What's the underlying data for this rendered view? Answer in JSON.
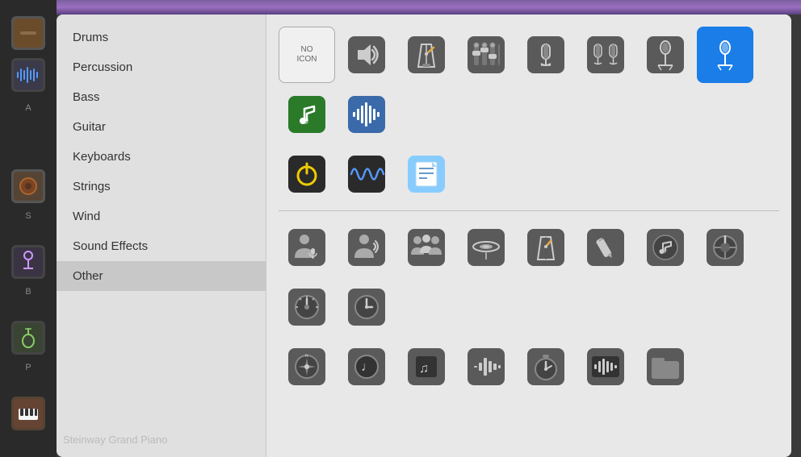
{
  "nav": {
    "items": [
      {
        "id": "drums",
        "label": "Drums",
        "active": false
      },
      {
        "id": "percussion",
        "label": "Percussion",
        "active": false
      },
      {
        "id": "bass",
        "label": "Bass",
        "active": false
      },
      {
        "id": "guitar",
        "label": "Guitar",
        "active": false
      },
      {
        "id": "keyboards",
        "label": "Keyboards",
        "active": false
      },
      {
        "id": "strings",
        "label": "Strings",
        "active": false
      },
      {
        "id": "wind",
        "label": "Wind",
        "active": false
      },
      {
        "id": "sound-effects",
        "label": "Sound Effects",
        "active": false
      },
      {
        "id": "other",
        "label": "Other",
        "active": true
      }
    ]
  },
  "icons": {
    "row1": [
      {
        "id": "no-icon",
        "type": "no-icon",
        "label": "NO ICON"
      },
      {
        "id": "speaker",
        "type": "speaker"
      },
      {
        "id": "metronome",
        "type": "metronome"
      },
      {
        "id": "mixer",
        "type": "mixer"
      },
      {
        "id": "mic-condenser",
        "type": "mic-condenser"
      },
      {
        "id": "mic-pair",
        "type": "mic-pair"
      },
      {
        "id": "mic-stand",
        "type": "mic-stand"
      },
      {
        "id": "mic-stand-selected",
        "type": "mic-stand-selected",
        "selected": true
      },
      {
        "id": "music-note-green",
        "type": "music-note-green"
      },
      {
        "id": "waveform-blue",
        "type": "waveform-blue"
      }
    ],
    "row2": [
      {
        "id": "power-yellow",
        "type": "power-yellow"
      },
      {
        "id": "waveform-wave",
        "type": "waveform-wave"
      },
      {
        "id": "notes-doc",
        "type": "notes-doc"
      }
    ],
    "row3": [
      {
        "id": "person-mic",
        "type": "person-mic"
      },
      {
        "id": "person-talking",
        "type": "person-talking"
      },
      {
        "id": "group",
        "type": "group"
      },
      {
        "id": "cymbal",
        "type": "cymbal"
      },
      {
        "id": "metronome2",
        "type": "metronome2"
      },
      {
        "id": "pencil",
        "type": "pencil"
      },
      {
        "id": "music-circle",
        "type": "music-circle"
      },
      {
        "id": "knob",
        "type": "knob"
      },
      {
        "id": "dial",
        "type": "dial"
      },
      {
        "id": "clock",
        "type": "clock"
      }
    ],
    "row4": [
      {
        "id": "compass",
        "type": "compass"
      },
      {
        "id": "music-note2",
        "type": "music-note2"
      },
      {
        "id": "note-dark",
        "type": "note-dark"
      },
      {
        "id": "waveform2",
        "type": "waveform2"
      },
      {
        "id": "timer",
        "type": "timer"
      },
      {
        "id": "waveform3",
        "type": "waveform3"
      },
      {
        "id": "folder",
        "type": "folder"
      }
    ]
  },
  "daw": {
    "bottom_label": "Steinway Grand Piano"
  }
}
